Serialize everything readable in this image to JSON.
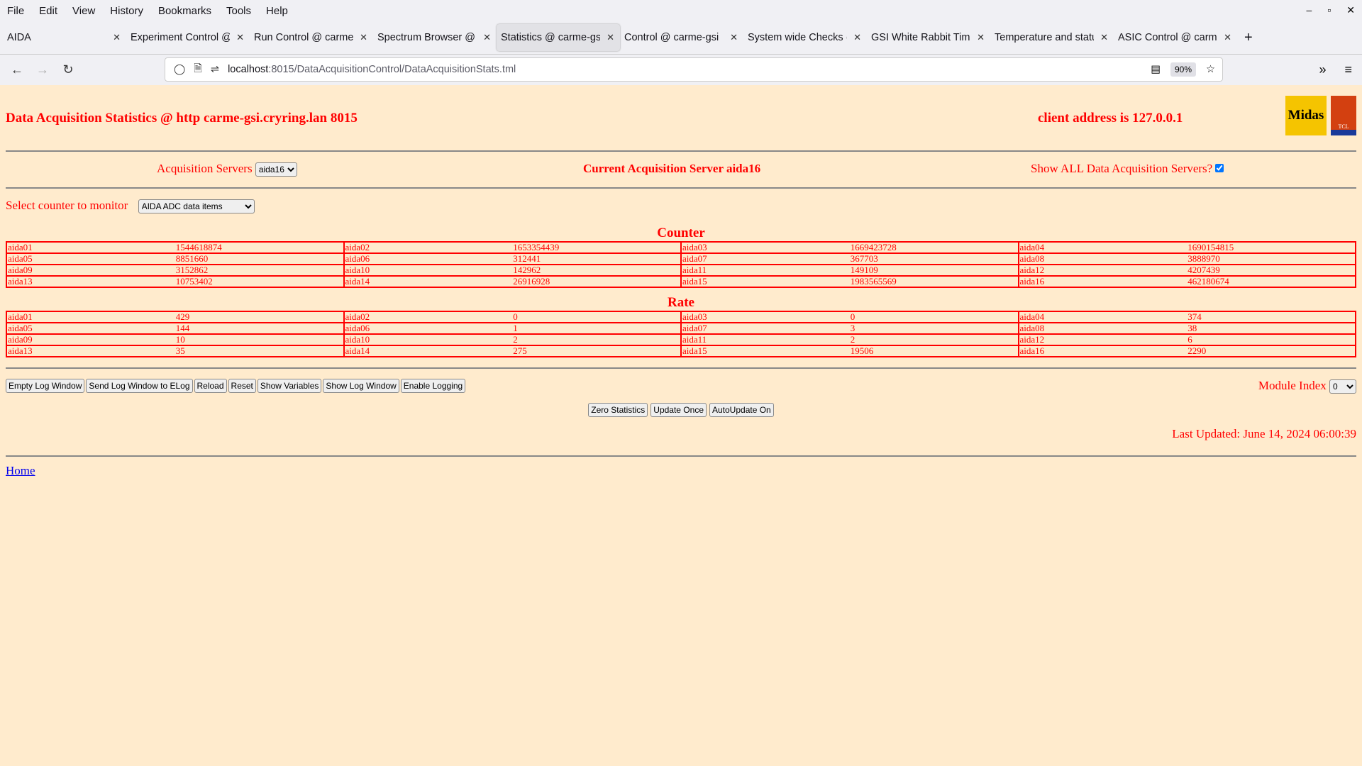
{
  "browser": {
    "menu": [
      "File",
      "Edit",
      "View",
      "History",
      "Bookmarks",
      "Tools",
      "Help"
    ],
    "tabs": [
      {
        "label": "AIDA"
      },
      {
        "label": "Experiment Control @ carme-gsi"
      },
      {
        "label": "Run Control @ carme-gsi"
      },
      {
        "label": "Spectrum Browser @ carme-gsi"
      },
      {
        "label": "Statistics @ carme-gsi",
        "active": true
      },
      {
        "label": "Control @ carme-gsi"
      },
      {
        "label": "System wide Checks @ carme-gsi"
      },
      {
        "label": "GSI White Rabbit Timestamp"
      },
      {
        "label": "Temperature and status"
      },
      {
        "label": "ASIC Control @ carme-gsi"
      }
    ],
    "url_host": "localhost",
    "url_path": ":8015/DataAcquisitionControl/DataAcquisitionStats.tml",
    "zoom": "90%"
  },
  "page": {
    "title": "Data Acquisition Statistics @ http carme-gsi.cryring.lan 8015",
    "client": "client address is 127.0.0.1",
    "logos": {
      "midas": "Midas",
      "tcl": "TCL POWERED"
    },
    "acq_label": "Acquisition Servers",
    "acq_value": "aida16",
    "current_server": "Current Acquisition Server aida16",
    "show_all_label": "Show ALL Data Acquisition Servers?",
    "show_all_checked": true,
    "select_label": "Select counter to monitor",
    "select_value": "AIDA ADC data items",
    "counter_heading": "Counter",
    "counter": [
      [
        [
          "aida01",
          "1544618874"
        ],
        [
          "aida02",
          "1653354439"
        ],
        [
          "aida03",
          "1669423728"
        ],
        [
          "aida04",
          "1690154815"
        ]
      ],
      [
        [
          "aida05",
          "8851660"
        ],
        [
          "aida06",
          "312441"
        ],
        [
          "aida07",
          "367703"
        ],
        [
          "aida08",
          "3888970"
        ]
      ],
      [
        [
          "aida09",
          "3152862"
        ],
        [
          "aida10",
          "142962"
        ],
        [
          "aida11",
          "149109"
        ],
        [
          "aida12",
          "4207439"
        ]
      ],
      [
        [
          "aida13",
          "10753402"
        ],
        [
          "aida14",
          "26916928"
        ],
        [
          "aida15",
          "1983565569"
        ],
        [
          "aida16",
          "462180674"
        ]
      ]
    ],
    "rate_heading": "Rate",
    "rate": [
      [
        [
          "aida01",
          "429"
        ],
        [
          "aida02",
          "0"
        ],
        [
          "aida03",
          "0"
        ],
        [
          "aida04",
          "374"
        ]
      ],
      [
        [
          "aida05",
          "144"
        ],
        [
          "aida06",
          "1"
        ],
        [
          "aida07",
          "3"
        ],
        [
          "aida08",
          "38"
        ]
      ],
      [
        [
          "aida09",
          "10"
        ],
        [
          "aida10",
          "2"
        ],
        [
          "aida11",
          "2"
        ],
        [
          "aida12",
          "6"
        ]
      ],
      [
        [
          "aida13",
          "35"
        ],
        [
          "aida14",
          "275"
        ],
        [
          "aida15",
          "19506"
        ],
        [
          "aida16",
          "2290"
        ]
      ]
    ],
    "buttons": [
      "Empty Log Window",
      "Send Log Window to ELog",
      "Reload",
      "Reset",
      "Show Variables",
      "Show Log Window",
      "Enable Logging"
    ],
    "module_index_label": "Module Index",
    "module_index_value": "0",
    "buttons2": [
      "Zero Statistics",
      "Update Once",
      "AutoUpdate On"
    ],
    "last_updated": "Last Updated: June 14, 2024 06:00:39",
    "home": "Home"
  }
}
